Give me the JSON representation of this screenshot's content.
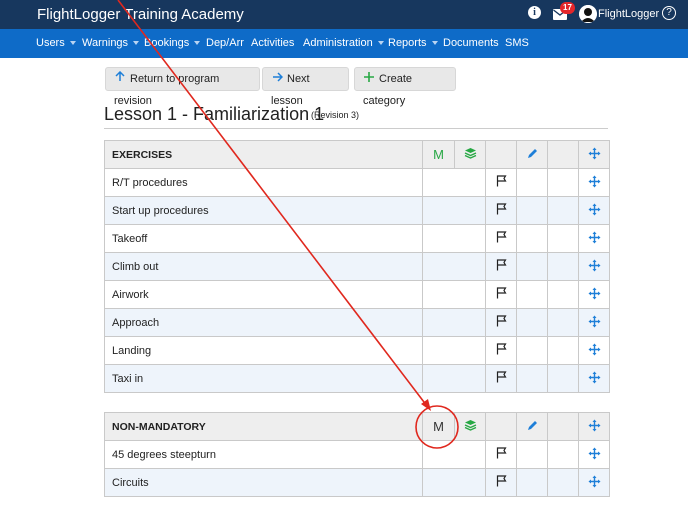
{
  "header": {
    "app_title": "FlightLogger Training Academy",
    "info_icon": "i",
    "mail_badge": "17",
    "user_name": "FlightLogger",
    "help_icon": "?"
  },
  "nav": {
    "items": [
      {
        "label": "Users",
        "dropdown": true
      },
      {
        "label": "Warnings",
        "dropdown": true
      },
      {
        "label": "Bookings",
        "dropdown": true
      },
      {
        "label": "Dep/Arr",
        "dropdown": false
      },
      {
        "label": "Activities",
        "dropdown": false
      },
      {
        "label": "Administration",
        "dropdown": true
      },
      {
        "label": "Reports",
        "dropdown": true
      },
      {
        "label": "Documents",
        "dropdown": false
      },
      {
        "label": "SMS",
        "dropdown": false
      }
    ]
  },
  "toolbar": {
    "return_label": "Return to program revision",
    "next_label": "Next lesson",
    "create_label": "Create category"
  },
  "lesson": {
    "title": "Lesson 1 - Familiarization 1",
    "revision": "(Revision 3)"
  },
  "categories": [
    {
      "name": "EXERCISES",
      "mandatory_marker": "M",
      "exercises": [
        "R/T procedures",
        "Start up procedures",
        "Takeoff",
        "Climb out",
        "Airwork",
        "Approach",
        "Landing",
        "Taxi in"
      ]
    },
    {
      "name": "NON-MANDATORY",
      "mandatory_marker": "M",
      "exercises": [
        "45 degrees steepturn",
        "Circuits"
      ]
    }
  ],
  "colors": {
    "header_bg": "#17375e",
    "nav_bg": "#0e6bc8",
    "accent_green": "#27a844",
    "move_icon_blue": "#1e7fd8",
    "annotation_red": "#e0281e"
  }
}
